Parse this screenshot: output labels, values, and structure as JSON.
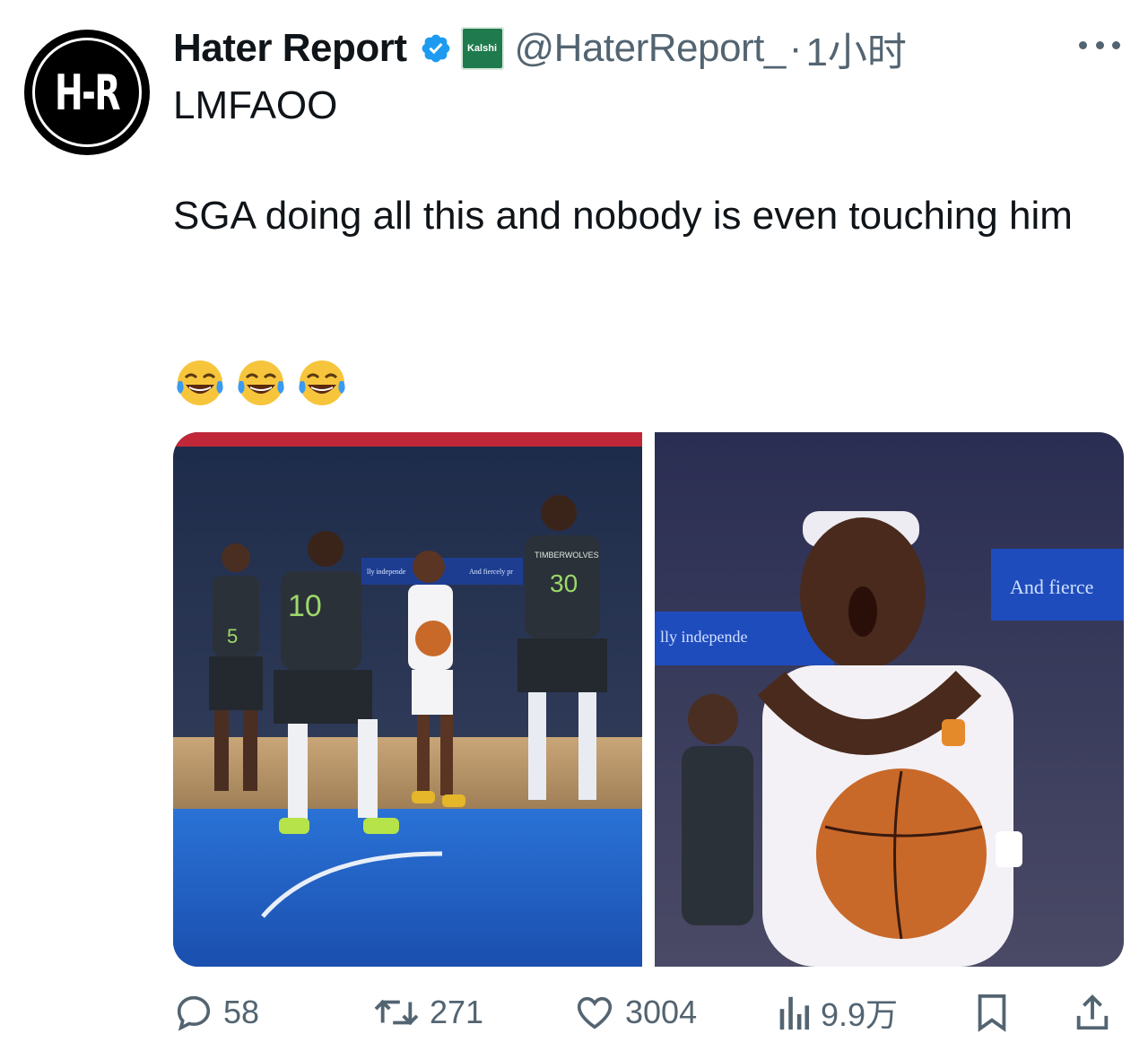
{
  "tweet": {
    "author_name": "Hater Report",
    "avatar_text": "H-R",
    "affiliate_badge": "Kalshi",
    "handle": "@HaterReport_",
    "separator": "·",
    "time": "1小时",
    "line1": "LMFAOO",
    "line2": "SGA doing all this and nobody is even touching him",
    "emojis": [
      "😂",
      "😂",
      "😂"
    ],
    "image_text": {
      "jersey_left": "5",
      "jersey_center": "10",
      "jersey_right": "30",
      "team_name": "TIMBERWOLVES",
      "banner_left": "lly independe",
      "banner_right": "And fiercely pr",
      "closeup_banner_left": "lly independe",
      "closeup_banner_right": "And fierce"
    }
  },
  "actions": {
    "replies": "58",
    "reposts": "271",
    "likes": "3004",
    "views": "9.9万"
  },
  "colors": {
    "text": "#0f1419",
    "secondary": "#536471",
    "verified": "#1d9bf0",
    "kalshi": "#1f7a4d",
    "court": "#1c5fc4"
  },
  "icons": [
    "more-icon",
    "verified-icon",
    "reply-icon",
    "repost-icon",
    "like-icon",
    "views-icon",
    "bookmark-icon",
    "share-icon"
  ]
}
